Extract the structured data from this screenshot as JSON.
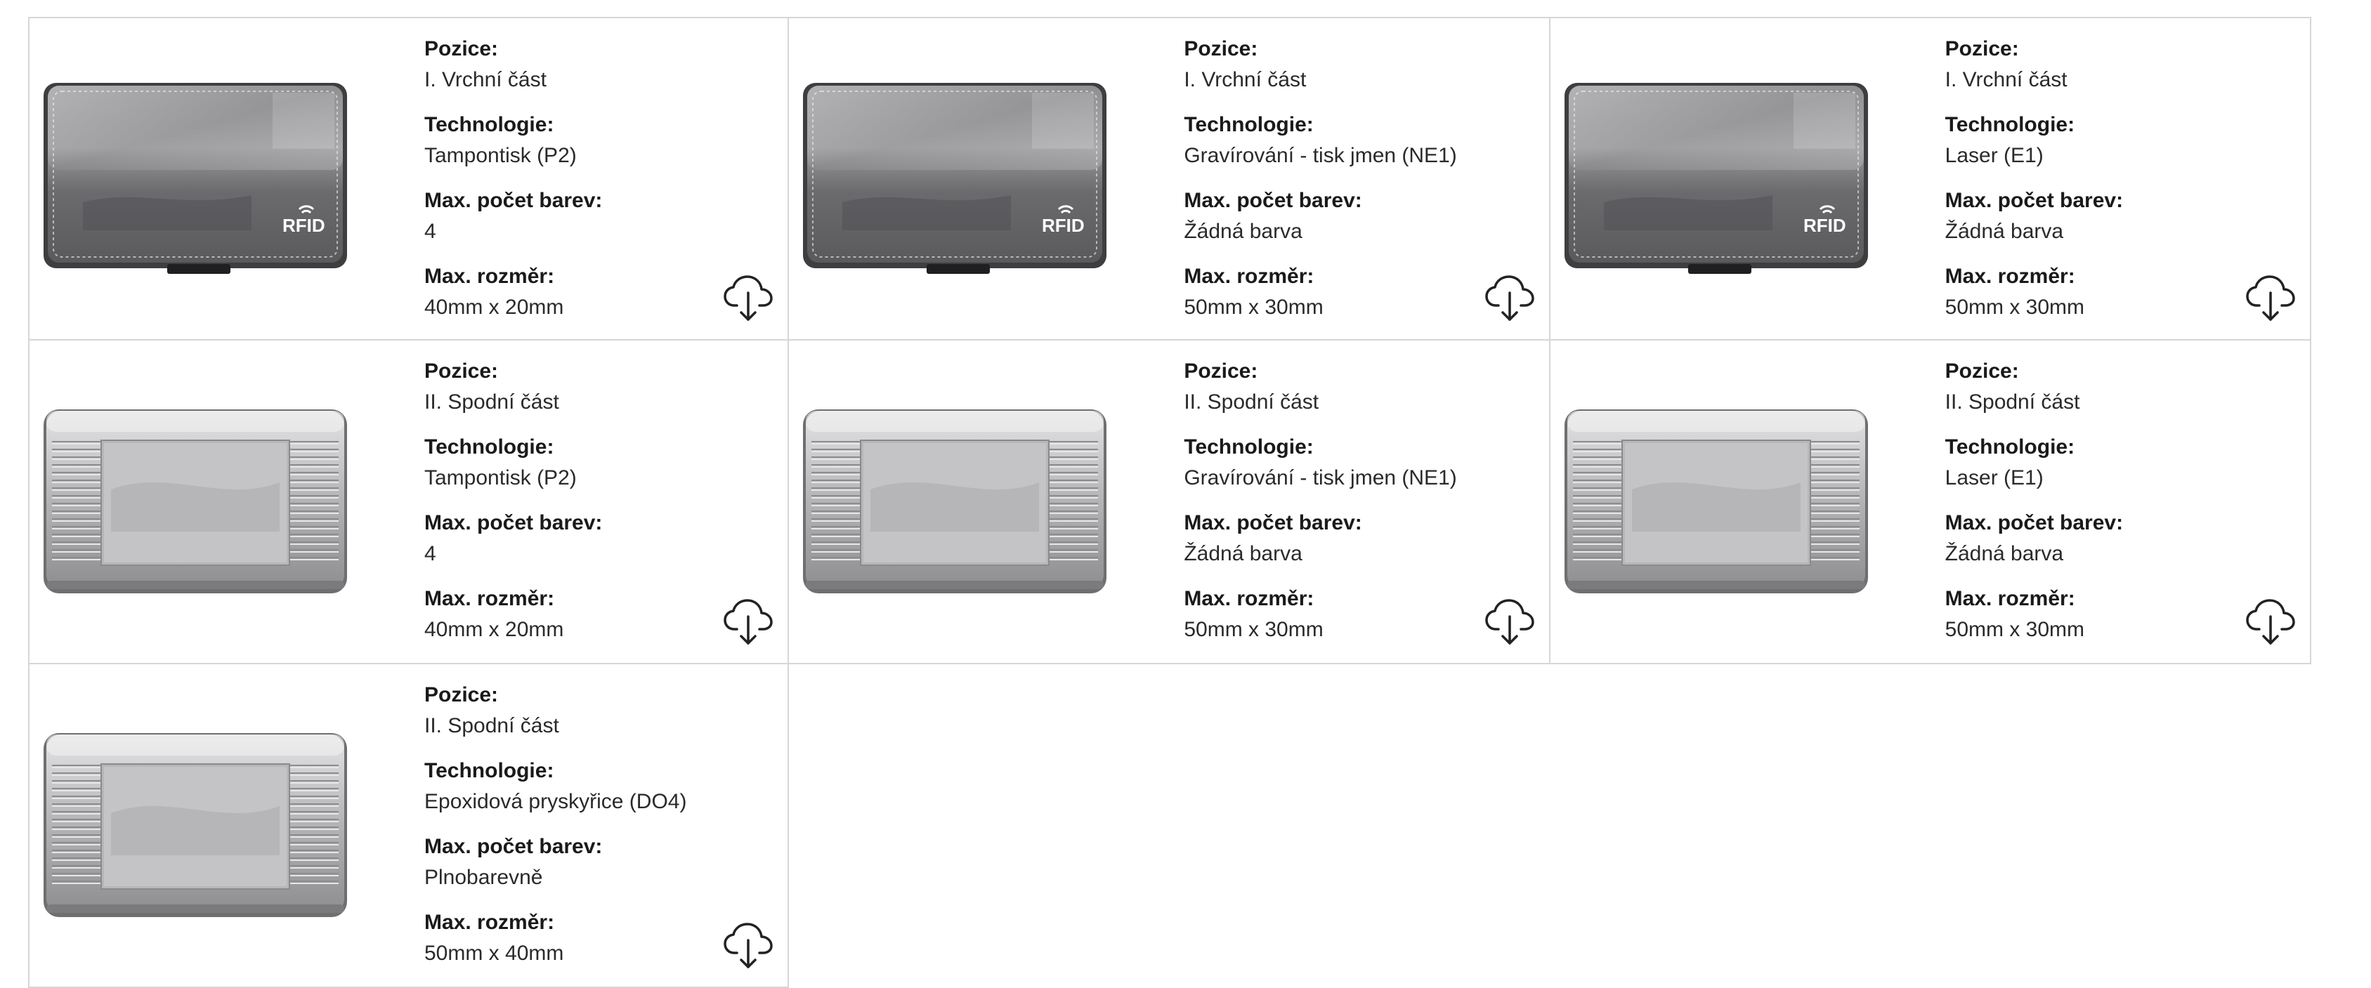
{
  "colors": {
    "border": "#d6d6d6",
    "text": "#222222",
    "case_dark": "#6d6d6f",
    "case_silver": "#b9b9bb"
  },
  "cards": [
    {
      "image": "rfid-card-case-top",
      "position_label": "Pozice:",
      "position": "I. Vrchní část",
      "technology_label": "Technologie:",
      "technology": "Tampontisk (P2)",
      "colors_label": "Max. počet barev:",
      "max_colors": "4",
      "size_label": "Max. rozměr:",
      "max_size": "40mm x 20mm",
      "logo_text": "RFID",
      "download_icon": "cloud-download-icon"
    },
    {
      "image": "rfid-card-case-top",
      "position_label": "Pozice:",
      "position": "I. Vrchní část",
      "technology_label": "Technologie:",
      "technology": "Gravírování - tisk jmen (NE1)",
      "colors_label": "Max. počet barev:",
      "max_colors": "Žádná barva",
      "size_label": "Max. rozměr:",
      "max_size": "50mm x 30mm",
      "logo_text": "RFID",
      "download_icon": "cloud-download-icon"
    },
    {
      "image": "rfid-card-case-top",
      "position_label": "Pozice:",
      "position": "I. Vrchní část",
      "technology_label": "Technologie:",
      "technology": "Laser (E1)",
      "colors_label": "Max. počet barev:",
      "max_colors": "Žádná barva",
      "size_label": "Max. rozměr:",
      "max_size": "50mm x 30mm",
      "logo_text": "RFID",
      "download_icon": "cloud-download-icon"
    },
    {
      "image": "card-case-bottom-ribbed",
      "position_label": "Pozice:",
      "position": "II. Spodní část",
      "technology_label": "Technologie:",
      "technology": "Tampontisk (P2)",
      "colors_label": "Max. počet barev:",
      "max_colors": "4",
      "size_label": "Max. rozměr:",
      "max_size": "40mm x 20mm",
      "download_icon": "cloud-download-icon"
    },
    {
      "image": "card-case-bottom-ribbed",
      "position_label": "Pozice:",
      "position": "II. Spodní část",
      "technology_label": "Technologie:",
      "technology": "Gravírování - tisk jmen (NE1)",
      "colors_label": "Max. počet barev:",
      "max_colors": "Žádná barva",
      "size_label": "Max. rozměr:",
      "max_size": "50mm x 30mm",
      "download_icon": "cloud-download-icon"
    },
    {
      "image": "card-case-bottom-ribbed",
      "position_label": "Pozice:",
      "position": "II. Spodní část",
      "technology_label": "Technologie:",
      "technology": "Laser (E1)",
      "colors_label": "Max. počet barev:",
      "max_colors": "Žádná barva",
      "size_label": "Max. rozměr:",
      "max_size": "50mm x 30mm",
      "download_icon": "cloud-download-icon"
    },
    {
      "image": "card-case-bottom-ribbed",
      "position_label": "Pozice:",
      "position": "II. Spodní část",
      "technology_label": "Technologie:",
      "technology": "Epoxidová pryskyřice (DO4)",
      "colors_label": "Max. počet barev:",
      "max_colors": "Plnobarevně",
      "size_label": "Max. rozměr:",
      "max_size": "50mm x 40mm",
      "download_icon": "cloud-download-icon"
    }
  ]
}
